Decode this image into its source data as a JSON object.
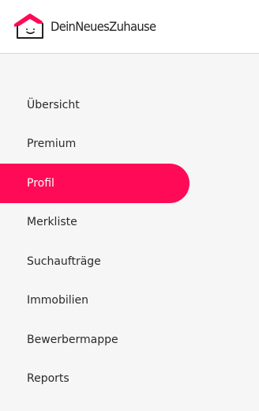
{
  "header": {
    "brand_name": "DeinNeuesZuhause",
    "logo_icon": "smiling-house-icon",
    "brand_color": "#ff0a57"
  },
  "nav": {
    "active_color": "#ff0a57",
    "items": [
      {
        "label": "Übersicht",
        "active": false
      },
      {
        "label": "Premium",
        "active": false
      },
      {
        "label": "Profil",
        "active": true
      },
      {
        "label": "Merkliste",
        "active": false
      },
      {
        "label": "Suchaufträge",
        "active": false
      },
      {
        "label": "Immobilien",
        "active": false
      },
      {
        "label": "Bewerbermappe",
        "active": false
      },
      {
        "label": "Reports",
        "active": false
      }
    ]
  }
}
